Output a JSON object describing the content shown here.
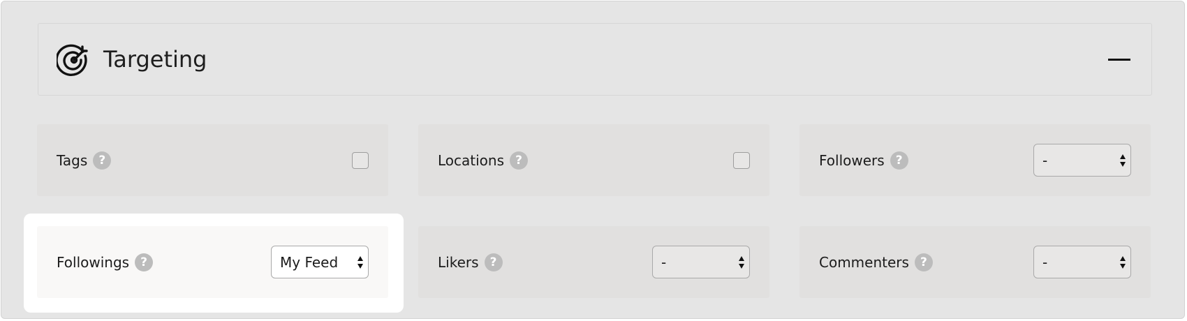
{
  "section": {
    "title": "Targeting",
    "icon": "target-icon",
    "toggle_icon": "minus-icon"
  },
  "cards": [
    {
      "label": "Tags",
      "help": "?",
      "control": "checkbox",
      "checked": false
    },
    {
      "label": "Locations",
      "help": "?",
      "control": "checkbox",
      "checked": false
    },
    {
      "label": "Followers",
      "help": "?",
      "control": "select",
      "value": "-"
    },
    {
      "label": "Followings",
      "help": "?",
      "control": "select",
      "value": "My Feed",
      "highlighted": true
    },
    {
      "label": "Likers",
      "help": "?",
      "control": "select",
      "value": "-"
    },
    {
      "label": "Commenters",
      "help": "?",
      "control": "select",
      "value": "-"
    }
  ],
  "colors": {
    "panel_bg": "#e5e5e5",
    "card_bg": "#e1e0df",
    "card_active_bg": "#f9f8f7",
    "help_bg": "#bcbcbc"
  }
}
